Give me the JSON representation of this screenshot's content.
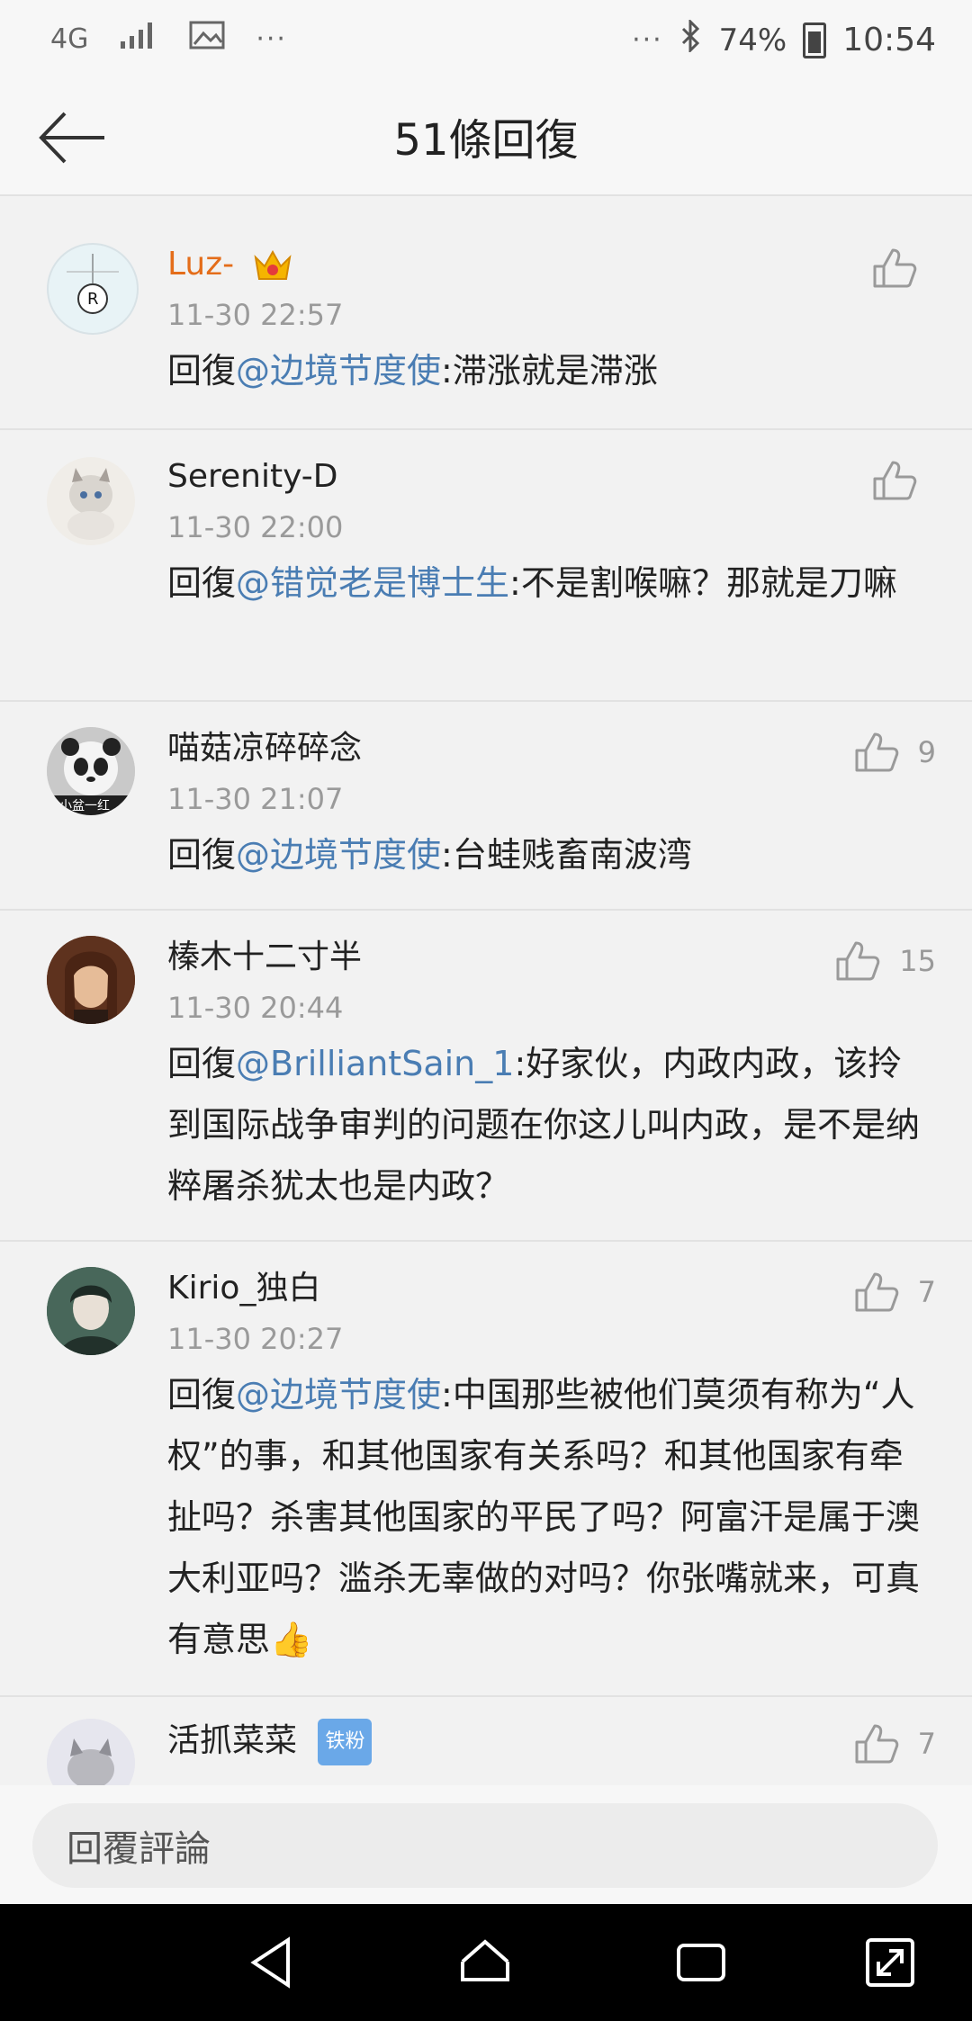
{
  "status": {
    "network": "4G",
    "battery": "74%",
    "time": "10:54"
  },
  "header": {
    "title": "51條回復"
  },
  "comments": [
    {
      "name": "Luz-",
      "time": "11-30 22:57",
      "prefix": "回復",
      "mention": "@边境节度使",
      "text": ":滞涨就是滞涨",
      "likes": ""
    },
    {
      "name": "Serenity-D",
      "time": "11-30 22:00",
      "prefix": "回復",
      "mention": "@错觉老是博士生",
      "text": ":不是割喉嘛？那就是刀嘛",
      "likes": ""
    },
    {
      "name": "喵菇凉碎碎念",
      "time": "11-30 21:07",
      "prefix": "回復",
      "mention": "@边境节度使",
      "text": ":台蛙贱畜南波湾",
      "likes": "9",
      "avatar_label": "小盆一红"
    },
    {
      "name": "榛木十二寸半",
      "time": "11-30 20:44",
      "prefix": "回復",
      "mention": "@BrilliantSain_1",
      "text": ":好家伙，内政内政，该拎到国际战争审判的问题在你这儿叫内政，是不是纳粹屠杀犹太也是内政？",
      "likes": "15"
    },
    {
      "name": "Kirio_独白",
      "time": "11-30 20:27",
      "prefix": "回復",
      "mention": "@边境节度使",
      "text": ":中国那些被他们莫须有称为“人权”的事，和其他国家有关系吗？和其他国家有牵扯吗？杀害其他国家的平民了吗？阿富汗是属于澳大利亚吗？滥杀无辜做的对吗？你张嘴就来，可真有意思👍",
      "likes": "7"
    },
    {
      "name": "活抓菜菜",
      "badge": "铁粉",
      "likes": "7"
    }
  ],
  "reply": {
    "placeholder": "回覆評論"
  }
}
